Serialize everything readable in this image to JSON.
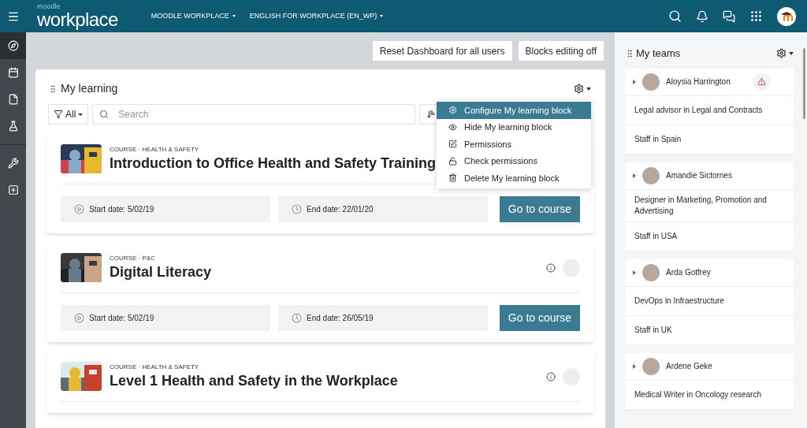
{
  "header": {
    "logo_top": "moodle",
    "logo_main": "workplace",
    "menus": [
      {
        "label": "MOODLE WORKPLACE"
      },
      {
        "label": "ENGLISH FOR WORKPLACE (EN_WP)"
      }
    ]
  },
  "nav": [
    {
      "kind": "compass",
      "selected": true
    },
    {
      "kind": "calendar",
      "selected": false
    },
    {
      "kind": "file",
      "selected": false
    },
    {
      "kind": "flask",
      "selected": false
    },
    {
      "kind": "tools",
      "selected": false
    },
    {
      "kind": "plus",
      "selected": false
    }
  ],
  "dashboard_buttons": [
    "Reset Dashboard for all users",
    "Blocks editing off"
  ],
  "learning": {
    "title": "My learning",
    "filter": "All",
    "search_placeholder": "Search",
    "menu": [
      {
        "kind": "gear",
        "label": "Configure My learning block",
        "selected": true
      },
      {
        "kind": "eye",
        "label": "Hide My learning block",
        "selected": false
      },
      {
        "kind": "edit",
        "label": "Permissions",
        "selected": false
      },
      {
        "kind": "lock",
        "label": "Check permissions",
        "selected": false
      },
      {
        "kind": "trash",
        "label": "Delete My learning block",
        "selected": false
      }
    ],
    "courses": [
      {
        "category": "COURSE · HEALTH & SAFETY",
        "title": "Introduction to Office Health and Safety Training",
        "start": "Start date: 5/02/19",
        "end": "End date: 22/01/20",
        "button": "Go to course"
      },
      {
        "category": "COURSE · P&C",
        "title": "Digital Literacy",
        "info_icon": true,
        "start": "Start date: 5/02/19",
        "end": "End date: 26/05/19",
        "button": "Go to course"
      },
      {
        "category": "COURSE · HEALTH & SAFETY",
        "title": "Level 1 Health and Safety in the Workplace",
        "info_icon": true
      }
    ]
  },
  "teams": {
    "title": "My teams",
    "members": [
      {
        "name": "Aloysia Harrington",
        "alert": true,
        "rows": [
          "Legal advisor in Legal and Contracts",
          "Staff in Spain"
        ]
      },
      {
        "name": "Amandie Sictornes",
        "alert": false,
        "rows": [
          "Designer in Marketing, Promotion and Advertising",
          "Staff in USA"
        ]
      },
      {
        "name": "Arda Gotfrey",
        "alert": false,
        "rows": [
          "DevOps in Infraestructure",
          "Staff in UK"
        ]
      },
      {
        "name": "Ardene Geke",
        "alert": false,
        "rows": [
          "Medical Writer in Oncology research"
        ]
      }
    ]
  }
}
